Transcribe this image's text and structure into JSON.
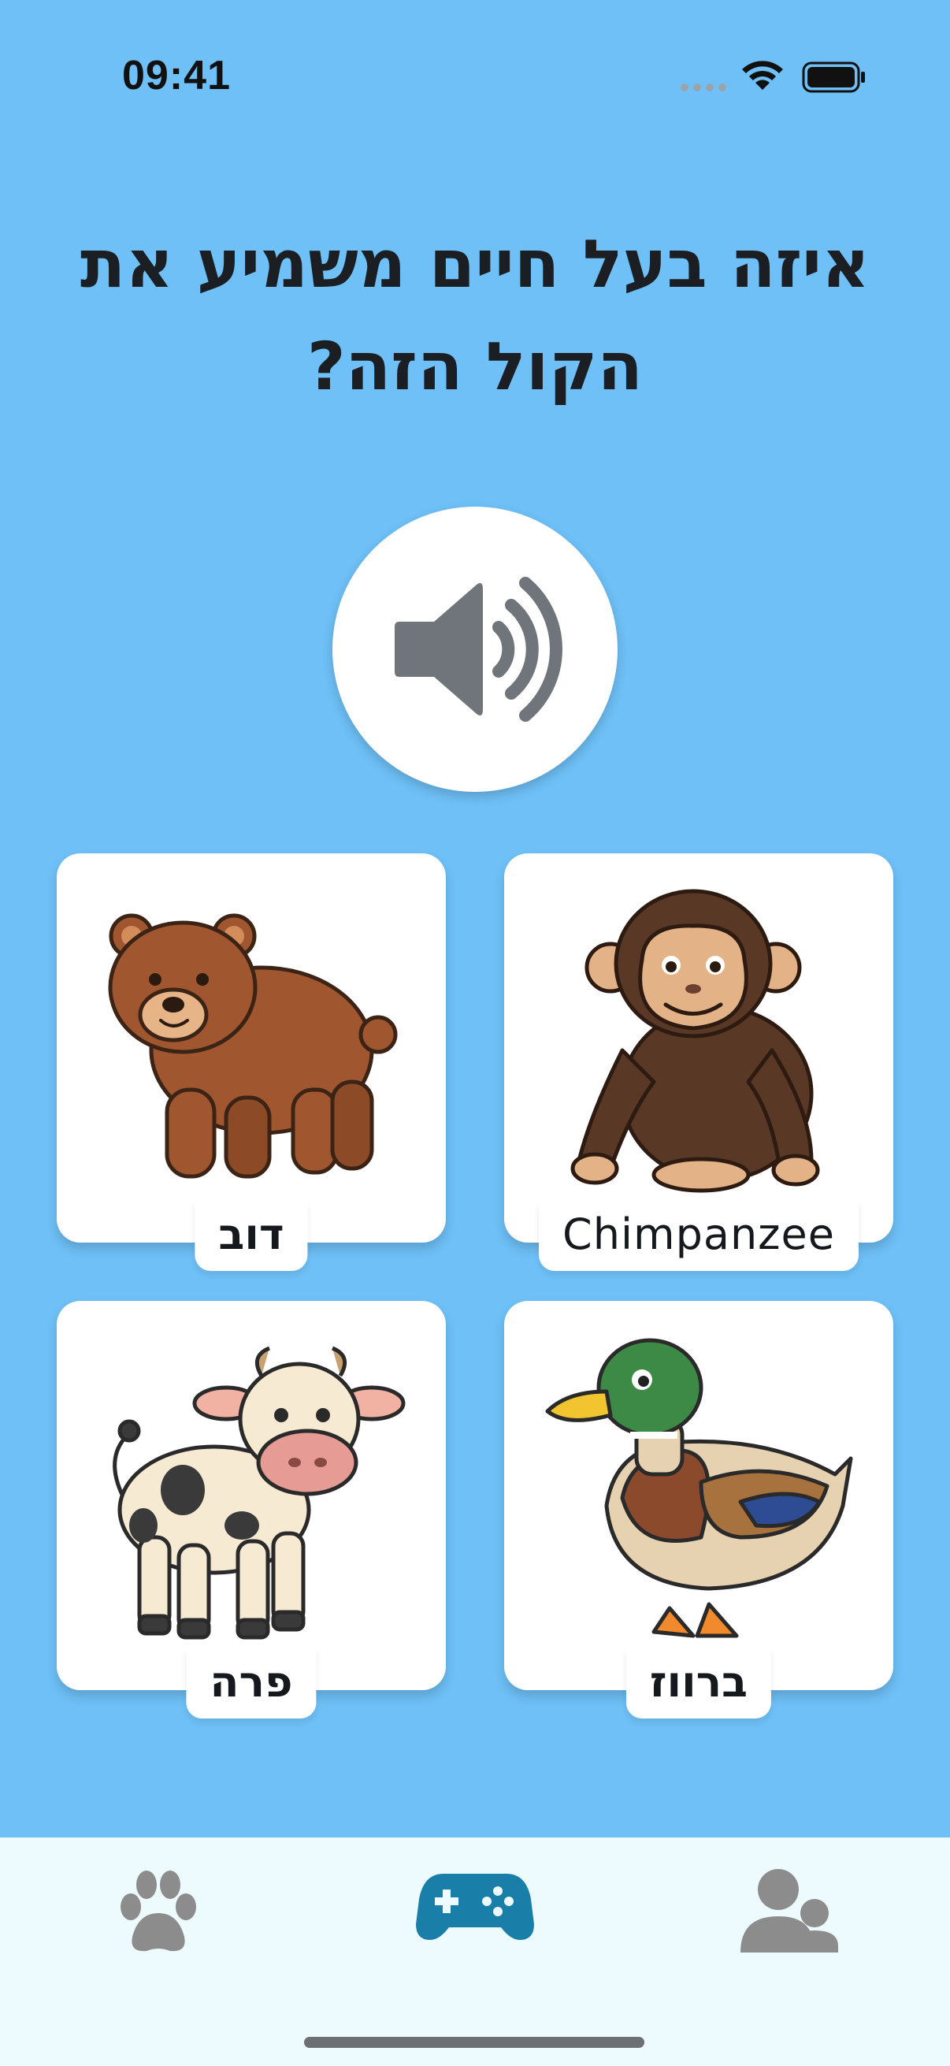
{
  "status_bar": {
    "time": "09:41"
  },
  "question": "איזה בעל חיים משמיע את הקול הזה?",
  "play_sound": {
    "icon": "speaker-volume-icon"
  },
  "options": [
    {
      "label": "דוב",
      "animal": "bear"
    },
    {
      "label": "Chimpanzee",
      "animal": "chimpanzee"
    },
    {
      "label": "פרה",
      "animal": "cow"
    },
    {
      "label": "ברווז",
      "animal": "duck"
    }
  ],
  "tab_bar": {
    "tabs": [
      {
        "icon": "paw-icon",
        "active": false
      },
      {
        "icon": "gamepad-icon",
        "active": true
      },
      {
        "icon": "users-icon",
        "active": false
      }
    ],
    "active_color": "#1A7FA8",
    "inactive_color": "#8C8C8C"
  },
  "colors": {
    "background": "#6EC0F7",
    "card": "#FFFFFF",
    "tab_bar": "#EDFAFE"
  }
}
